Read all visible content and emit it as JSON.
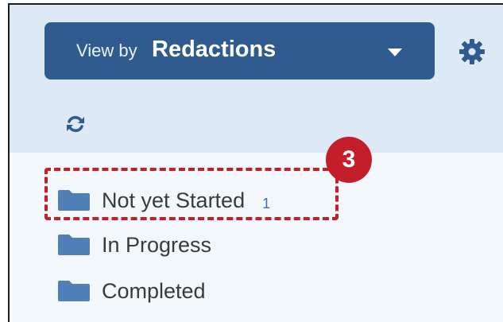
{
  "view_by": {
    "prefix": "View by",
    "value": "Redactions"
  },
  "icons": {
    "dropdown": "caret-down-icon",
    "settings": "gear-icon",
    "refresh": "refresh-icon",
    "folder": "folder-icon"
  },
  "folders": [
    {
      "label": "Not yet Started",
      "count": "1"
    },
    {
      "label": "In Progress"
    },
    {
      "label": "Completed"
    }
  ],
  "callout": {
    "number": "3",
    "color": "#c41e2a"
  },
  "colors": {
    "accent": "#2f5b8e",
    "header_band": "#dde9f4",
    "panel_bg": "#f2f7fc",
    "folder_icon": "#4f81b8"
  }
}
